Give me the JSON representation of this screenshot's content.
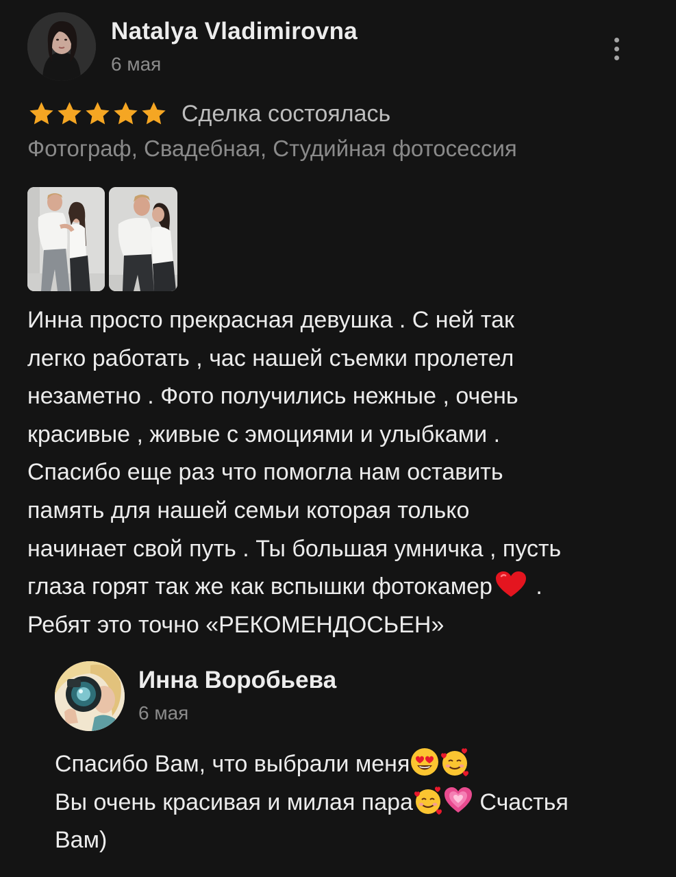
{
  "review": {
    "author": "Natalya Vladimirovna",
    "date": "6 мая",
    "rating": 5,
    "rating_max": 5,
    "status": "Сделка состоялась",
    "services": "Фотограф, Свадебная, Студийная фотосессия",
    "photos_count": 2,
    "text_before_heart": "Инна просто прекрасная девушка . С ней так\nлегко работать , час нашей съемки пролетел\nнезаметно . Фото получились нежные , очень\nкрасивые , живые с эмоциями и улыбками .\nСпасибо еще раз что помогла нам оставить\nпамять для нашей семьи которая только\nначинает свой путь . Ты большая умничка , пусть\nглаза горят так же как вспышки фотокамер",
    "text_after_heart": " .\nРебят это точно «РЕКОМЕНДОСЬЕН»"
  },
  "reply": {
    "author": "Инна Воробьева",
    "date": "6 мая",
    "line1": "Спасибо Вам, что выбрали меня",
    "line2": " Вы очень красивая и милая пара",
    "line2_end": " Счастья",
    "line3": "Вам)"
  },
  "colors": {
    "background": "#141414",
    "star": "#f5a623",
    "text": "#ececec",
    "muted": "#8a8a8a"
  },
  "icons": {
    "menu": "more-vertical-icon",
    "star": "star-icon",
    "heart": "red-heart-emoji",
    "heart_eyes": "heart-eyes-emoji",
    "smiling_hearts": "smiling-face-with-hearts-emoji",
    "pink_heart": "sparkling-heart-emoji"
  }
}
